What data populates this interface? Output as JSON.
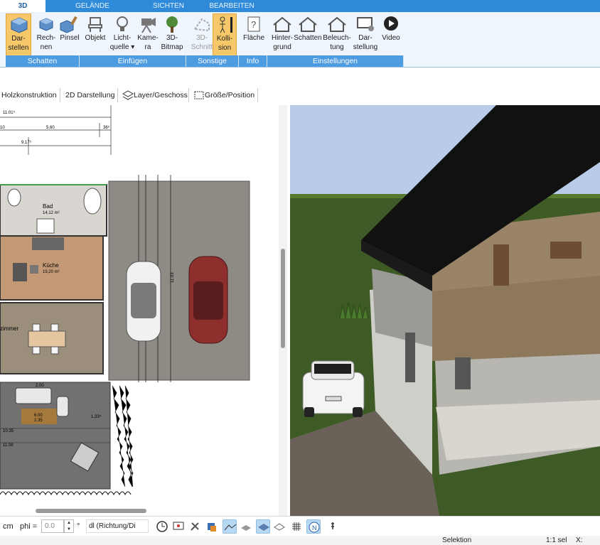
{
  "tabs": [
    "3D",
    "GELÄNDE",
    "SICHTEN",
    "BEARBEITEN"
  ],
  "ribbon": {
    "buttons": [
      {
        "l1": "Dar-",
        "l2": "stellen"
      },
      {
        "l1": "Rech-",
        "l2": "nen"
      },
      {
        "l1": "Pinsel",
        "l2": ""
      },
      {
        "l1": "Objekt",
        "l2": ""
      },
      {
        "l1": "Licht-",
        "l2": "quelle"
      },
      {
        "l1": "Kame-",
        "l2": "ra"
      },
      {
        "l1": "3D-",
        "l2": "Bitmap"
      },
      {
        "l1": "3D-",
        "l2": "Schnitt"
      },
      {
        "l1": "Kolli-",
        "l2": "sion"
      },
      {
        "l1": "Fläche",
        "l2": ""
      },
      {
        "l1": "Hinter-",
        "l2": "grund"
      },
      {
        "l1": "Schatten",
        "l2": ""
      },
      {
        "l1": "Beleuch-",
        "l2": "tung"
      },
      {
        "l1": "Dar-",
        "l2": "stellung"
      },
      {
        "l1": "Video",
        "l2": ""
      }
    ],
    "groups": [
      "Schatten",
      "Einfügen",
      "Sonstige",
      "Info",
      "Einstellungen"
    ]
  },
  "toolbar2": {
    "holz": "Holzkonstruktion",
    "d2": "2D Darstellung",
    "layer": "Layer/Geschoss",
    "groesse": "Größe/Position"
  },
  "plan": {
    "dims": {
      "d1": "11.01⁵",
      "d2": "10",
      "d3": "5.60",
      "d4": "36⁵",
      "d5": "9.17⁵",
      "d6": "6.00",
      "d7": "2.35",
      "d8": "1.33⁵",
      "d9": "10.35",
      "d10": "11.08",
      "d11": "2.00",
      "d12": "11.03"
    },
    "rooms": [
      {
        "name": "Bad",
        "area": "14,12 m²"
      },
      {
        "name": "Küche",
        "area": "19,20 m²"
      },
      {
        "name": "zimmer",
        "area": ""
      }
    ]
  },
  "bottom": {
    "unit": "cm",
    "phi_label": "phi =",
    "phi_value": "0.0",
    "dl_label": "dl (Richtung/Di"
  },
  "status": {
    "mode": "Selektion",
    "sel": "1:1 sel",
    "x": "X:"
  },
  "colors": {
    "accent": "#2f8bd9",
    "ribbon_bg": "#eef5fc",
    "selected": "#f7c86a",
    "grass": "#3e5a25",
    "sky": "#b8cbe9",
    "roof": "#111111",
    "wood": "#9a8468"
  }
}
